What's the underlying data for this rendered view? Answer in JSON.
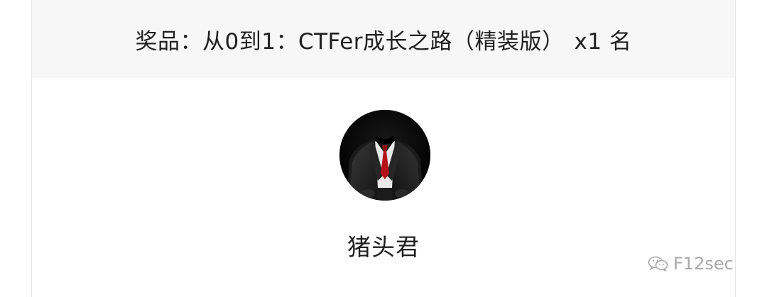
{
  "prize": {
    "label": "奖品：",
    "name": "从0到1：CTFer成长之路（精装版）",
    "quantity": "x1 名"
  },
  "winner": {
    "name": "猪头君"
  },
  "watermark": {
    "account": "F12sec"
  },
  "colors": {
    "header_bg": "#f7f7f7",
    "text": "#1f1f1f",
    "watermark": "#a9a9a9",
    "tie": "#b3121b"
  }
}
